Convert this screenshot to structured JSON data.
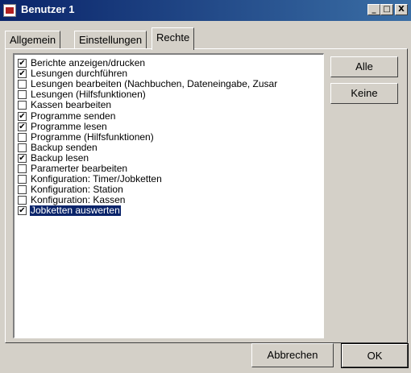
{
  "window": {
    "title": "Benutzer 1",
    "minimize": "_",
    "maximize": "□",
    "close": "X"
  },
  "tabs": [
    {
      "label": "Allgemein"
    },
    {
      "label": "Einstellungen"
    },
    {
      "label": "Rechte",
      "active": true
    }
  ],
  "permissions": [
    {
      "label": "Berichte anzeigen/drucken",
      "checked": true
    },
    {
      "label": "Lesungen durchführen",
      "checked": true
    },
    {
      "label": "Lesungen bearbeiten (Nachbuchen, Dateneingabe, Zusar",
      "checked": false
    },
    {
      "label": "Lesungen (Hilfsfunktionen)",
      "checked": false
    },
    {
      "label": "Kassen bearbeiten",
      "checked": false
    },
    {
      "label": "Programme senden",
      "checked": true
    },
    {
      "label": "Programme lesen",
      "checked": true
    },
    {
      "label": "Programme (Hilfsfunktionen)",
      "checked": false
    },
    {
      "label": "Backup senden",
      "checked": false
    },
    {
      "label": "Backup lesen",
      "checked": true
    },
    {
      "label": "Paramerter bearbeiten",
      "checked": false
    },
    {
      "label": "Konfiguration: Timer/Jobketten",
      "checked": false
    },
    {
      "label": "Konfiguration: Station",
      "checked": false
    },
    {
      "label": "Konfiguration: Kassen",
      "checked": false
    },
    {
      "label": "Jobketten auswerten",
      "checked": true,
      "selected": true
    }
  ],
  "buttons": {
    "all": "Alle",
    "none": "Keine",
    "cancel": "Abbrechen",
    "ok": "OK"
  },
  "icons": {
    "app": "app-window-icon",
    "check": "✔"
  },
  "colors": {
    "titlebar": "#0a246a",
    "selection": "#0a246a",
    "face": "#d4d0c8"
  }
}
